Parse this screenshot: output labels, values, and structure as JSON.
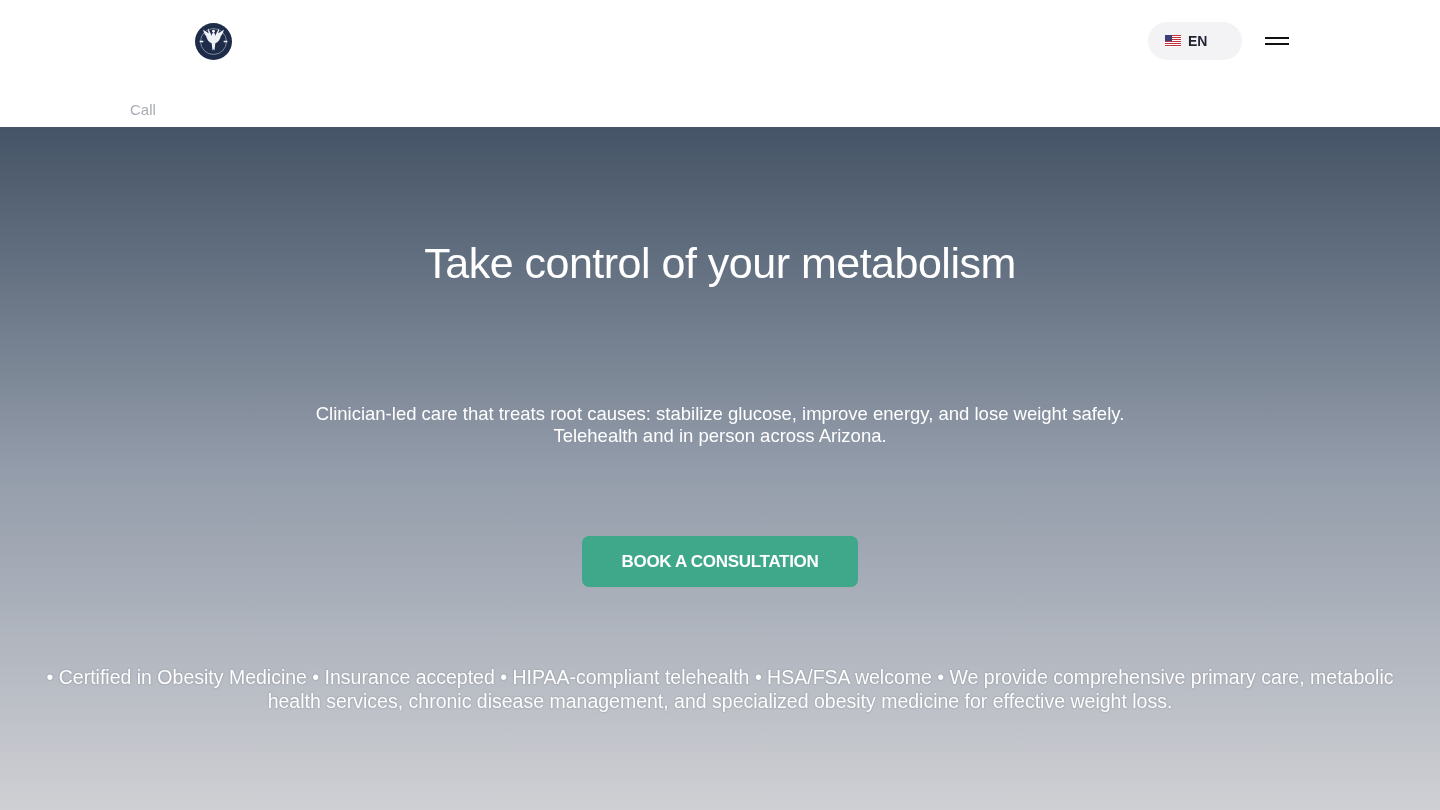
{
  "header": {
    "language": {
      "code": "EN"
    },
    "call_link": "Call"
  },
  "hero": {
    "title": "Take control of your metabolism",
    "subtitle_lines": [
      "Clinician-led care that treats root causes: stabilize glucose, improve energy, and lose weight safely.",
      "Telehealth and in person across Arizona."
    ],
    "button": "BOOK A CONSULTATION",
    "features": "• Certified in Obesity Medicine • Insurance accepted • HIPAA-compliant telehealth • HSA/FSA welcome • We provide comprehensive primary care, metabolic health services, chronic disease management, and specialized obesity medicine for effective weight loss."
  }
}
